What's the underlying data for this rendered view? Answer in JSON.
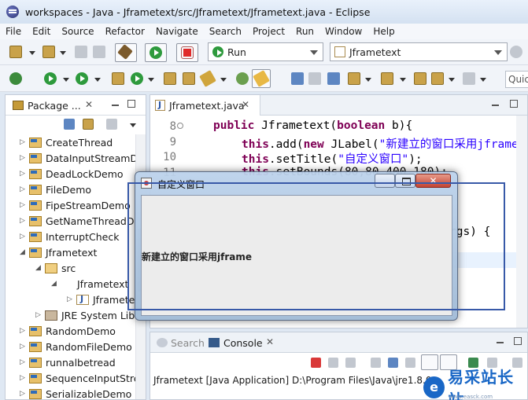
{
  "window": {
    "title": "workspaces - Java - Jframetext/src/Jframetext/Jframetext.java - Eclipse"
  },
  "menu": [
    "File",
    "Edit",
    "Source",
    "Refactor",
    "Navigate",
    "Search",
    "Project",
    "Run",
    "Window",
    "Help"
  ],
  "toolbar": {
    "run_combo": "Run",
    "launch_combo": "Jframetext",
    "quick_access": "Quic"
  },
  "package_explorer": {
    "title": "Package ...",
    "items": [
      {
        "label": "CreateThread",
        "kind": "project",
        "expanded": false
      },
      {
        "label": "DataInputStreamDe",
        "kind": "project",
        "expanded": false
      },
      {
        "label": "DeadLockDemo",
        "kind": "project",
        "expanded": false
      },
      {
        "label": "FileDemo",
        "kind": "project",
        "expanded": false
      },
      {
        "label": "FipeStreamDemo",
        "kind": "project",
        "expanded": false
      },
      {
        "label": "GetNameThreadDe",
        "kind": "project",
        "expanded": false
      },
      {
        "label": "InterruptCheck",
        "kind": "project",
        "expanded": false
      },
      {
        "label": "Jframetext",
        "kind": "project",
        "expanded": true
      },
      {
        "label": "src",
        "kind": "src",
        "expanded": true
      },
      {
        "label": "Jframetext",
        "kind": "package",
        "expanded": true
      },
      {
        "label": "Jframetex",
        "kind": "java",
        "expanded": false
      },
      {
        "label": "JRE System Libr",
        "kind": "lib",
        "expanded": false
      },
      {
        "label": "RandomDemo",
        "kind": "project",
        "expanded": false
      },
      {
        "label": "RandomFileDemo",
        "kind": "project",
        "expanded": false
      },
      {
        "label": "runnalbetread",
        "kind": "project",
        "expanded": false
      },
      {
        "label": "SequenceInputStre",
        "kind": "project",
        "expanded": false
      },
      {
        "label": "SerializableDemo",
        "kind": "project",
        "expanded": false
      }
    ]
  },
  "editor": {
    "tab_label": "Jframetext.java",
    "line_numbers": [
      "8",
      "9",
      "10",
      "11"
    ],
    "lines": [
      {
        "kw1": "public",
        "rest": " Jframetext(",
        "kw2": "boolean",
        "tail": " b){"
      },
      {
        "kw1": "this",
        "rest": ".add(",
        "kw2": "new",
        "tail": " JLabel(",
        "str": "\"新建立的窗口采用jframe\"",
        "end": ")"
      },
      {
        "kw1": "this",
        "rest": ".setTitle(",
        "str": "\"自定义窗口\"",
        "end": ");"
      },
      {
        "kw1": "this",
        "rest": ".setBounds(80,80,400,180);"
      }
    ],
    "visible_fragment": "rgs) {"
  },
  "jframe": {
    "title": "自定义窗口",
    "label_text": "新建立的窗口采用jframe"
  },
  "console": {
    "search_tab": "Search",
    "console_tab": "Console",
    "output": "Jframetext [Java Application] D:\\Program Files\\Java\\jre1.8.0"
  },
  "watermark": {
    "brand": "易采站长站",
    "url": "www.easck.com"
  }
}
